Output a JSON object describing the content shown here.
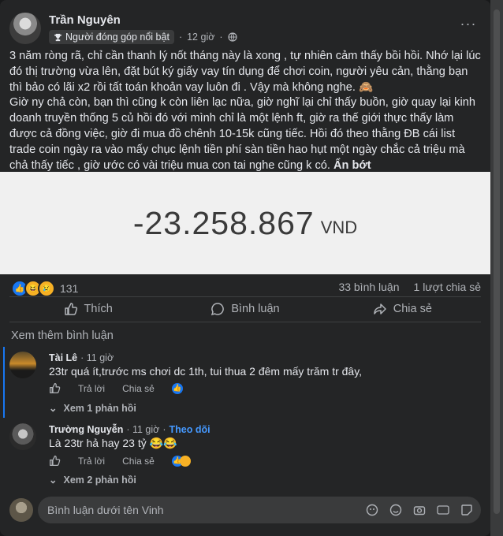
{
  "post": {
    "author": "Trần Nguyên",
    "badge": "Người đóng góp nổi bật",
    "time": "12 giờ",
    "paragraph1": "3 năm ròng rã, chỉ cần thanh lý nốt tháng này là xong , tự nhiên cảm thấy bồi hồi. Nhớ lại lúc đó thị trường vừa lên, đặt bút ký giấy vay tín dụng để chơi coin, người yêu cản, thằng bạn thì bảo có lãi x2 rồi tất toán khoản vay luôn đi . Vậy mà không nghe. 🙈",
    "paragraph2": "Giờ ny chả còn, bạn thì cũng k còn liên lạc nữa, giờ nghĩ lại chỉ thấy buồn, giờ quay lại kinh doanh truyền thống 5 củ hồi đó với mình chỉ là một lệnh ft, giờ ra thế giới thực thấy làm được cả đồng việc, giờ đi mua đồ chênh 10-15k cũng tiếc. Hồi đó theo thằng ĐB cái list trade coin ngày ra vào mấy chục lệnh tiền phí sàn tiền hao hụt một ngày chắc cả triệu mà chả thấy tiếc , giờ ước có vài triệu mua con tai nghe cũng k có.",
    "see_less": "Ẩn bớt",
    "amount": "-23.258.867",
    "currency": "VND"
  },
  "stats": {
    "reaction_count": "131",
    "comments": "33 bình luận",
    "shares": "1 lượt chia sẻ"
  },
  "actions": {
    "like": "Thích",
    "comment": "Bình luận",
    "share": "Chia sẻ"
  },
  "more_comments": "Xem thêm bình luận",
  "comments": [
    {
      "name": "Tài Lê",
      "time": "11 giờ",
      "follow": "",
      "text": "23tr quá ít,trước ms chơi dc 1th, tui thua 2 đêm mấy trăm tr đây,",
      "reply": "Trả lời",
      "share": "Chia sẻ",
      "replies": "Xem 1 phản hồi"
    },
    {
      "name": "Trường Nguyễn",
      "time": "11 giờ",
      "follow": "Theo dõi",
      "text": "Là 23tr hả hay 23 tỷ 😂😂",
      "reply": "Trả lời",
      "share": "Chia sẻ",
      "replies": "Xem 2 phản hồi"
    }
  ],
  "composer": {
    "placeholder": "Bình luận dưới tên Vinh"
  },
  "colors": {
    "background": "#18191a",
    "card": "#242526",
    "accent": "#1877f2",
    "follow_link": "#4599ff"
  }
}
